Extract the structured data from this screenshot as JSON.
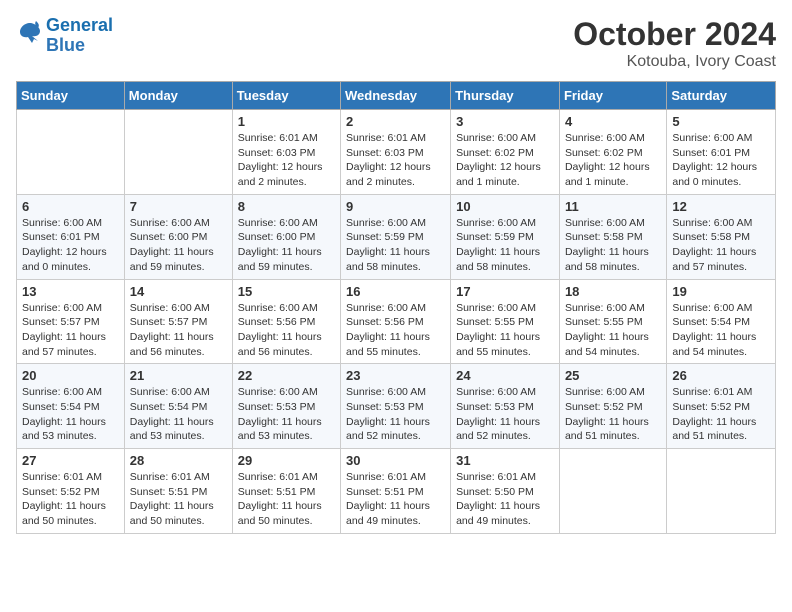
{
  "header": {
    "logo_line1": "General",
    "logo_line2": "Blue",
    "title": "October 2024",
    "subtitle": "Kotouba, Ivory Coast"
  },
  "days_of_week": [
    "Sunday",
    "Monday",
    "Tuesday",
    "Wednesday",
    "Thursday",
    "Friday",
    "Saturday"
  ],
  "weeks": [
    [
      {
        "day": "",
        "info": ""
      },
      {
        "day": "",
        "info": ""
      },
      {
        "day": "1",
        "info": "Sunrise: 6:01 AM\nSunset: 6:03 PM\nDaylight: 12 hours and 2 minutes."
      },
      {
        "day": "2",
        "info": "Sunrise: 6:01 AM\nSunset: 6:03 PM\nDaylight: 12 hours and 2 minutes."
      },
      {
        "day": "3",
        "info": "Sunrise: 6:00 AM\nSunset: 6:02 PM\nDaylight: 12 hours and 1 minute."
      },
      {
        "day": "4",
        "info": "Sunrise: 6:00 AM\nSunset: 6:02 PM\nDaylight: 12 hours and 1 minute."
      },
      {
        "day": "5",
        "info": "Sunrise: 6:00 AM\nSunset: 6:01 PM\nDaylight: 12 hours and 0 minutes."
      }
    ],
    [
      {
        "day": "6",
        "info": "Sunrise: 6:00 AM\nSunset: 6:01 PM\nDaylight: 12 hours and 0 minutes."
      },
      {
        "day": "7",
        "info": "Sunrise: 6:00 AM\nSunset: 6:00 PM\nDaylight: 11 hours and 59 minutes."
      },
      {
        "day": "8",
        "info": "Sunrise: 6:00 AM\nSunset: 6:00 PM\nDaylight: 11 hours and 59 minutes."
      },
      {
        "day": "9",
        "info": "Sunrise: 6:00 AM\nSunset: 5:59 PM\nDaylight: 11 hours and 58 minutes."
      },
      {
        "day": "10",
        "info": "Sunrise: 6:00 AM\nSunset: 5:59 PM\nDaylight: 11 hours and 58 minutes."
      },
      {
        "day": "11",
        "info": "Sunrise: 6:00 AM\nSunset: 5:58 PM\nDaylight: 11 hours and 58 minutes."
      },
      {
        "day": "12",
        "info": "Sunrise: 6:00 AM\nSunset: 5:58 PM\nDaylight: 11 hours and 57 minutes."
      }
    ],
    [
      {
        "day": "13",
        "info": "Sunrise: 6:00 AM\nSunset: 5:57 PM\nDaylight: 11 hours and 57 minutes."
      },
      {
        "day": "14",
        "info": "Sunrise: 6:00 AM\nSunset: 5:57 PM\nDaylight: 11 hours and 56 minutes."
      },
      {
        "day": "15",
        "info": "Sunrise: 6:00 AM\nSunset: 5:56 PM\nDaylight: 11 hours and 56 minutes."
      },
      {
        "day": "16",
        "info": "Sunrise: 6:00 AM\nSunset: 5:56 PM\nDaylight: 11 hours and 55 minutes."
      },
      {
        "day": "17",
        "info": "Sunrise: 6:00 AM\nSunset: 5:55 PM\nDaylight: 11 hours and 55 minutes."
      },
      {
        "day": "18",
        "info": "Sunrise: 6:00 AM\nSunset: 5:55 PM\nDaylight: 11 hours and 54 minutes."
      },
      {
        "day": "19",
        "info": "Sunrise: 6:00 AM\nSunset: 5:54 PM\nDaylight: 11 hours and 54 minutes."
      }
    ],
    [
      {
        "day": "20",
        "info": "Sunrise: 6:00 AM\nSunset: 5:54 PM\nDaylight: 11 hours and 53 minutes."
      },
      {
        "day": "21",
        "info": "Sunrise: 6:00 AM\nSunset: 5:54 PM\nDaylight: 11 hours and 53 minutes."
      },
      {
        "day": "22",
        "info": "Sunrise: 6:00 AM\nSunset: 5:53 PM\nDaylight: 11 hours and 53 minutes."
      },
      {
        "day": "23",
        "info": "Sunrise: 6:00 AM\nSunset: 5:53 PM\nDaylight: 11 hours and 52 minutes."
      },
      {
        "day": "24",
        "info": "Sunrise: 6:00 AM\nSunset: 5:53 PM\nDaylight: 11 hours and 52 minutes."
      },
      {
        "day": "25",
        "info": "Sunrise: 6:00 AM\nSunset: 5:52 PM\nDaylight: 11 hours and 51 minutes."
      },
      {
        "day": "26",
        "info": "Sunrise: 6:01 AM\nSunset: 5:52 PM\nDaylight: 11 hours and 51 minutes."
      }
    ],
    [
      {
        "day": "27",
        "info": "Sunrise: 6:01 AM\nSunset: 5:52 PM\nDaylight: 11 hours and 50 minutes."
      },
      {
        "day": "28",
        "info": "Sunrise: 6:01 AM\nSunset: 5:51 PM\nDaylight: 11 hours and 50 minutes."
      },
      {
        "day": "29",
        "info": "Sunrise: 6:01 AM\nSunset: 5:51 PM\nDaylight: 11 hours and 50 minutes."
      },
      {
        "day": "30",
        "info": "Sunrise: 6:01 AM\nSunset: 5:51 PM\nDaylight: 11 hours and 49 minutes."
      },
      {
        "day": "31",
        "info": "Sunrise: 6:01 AM\nSunset: 5:50 PM\nDaylight: 11 hours and 49 minutes."
      },
      {
        "day": "",
        "info": ""
      },
      {
        "day": "",
        "info": ""
      }
    ]
  ]
}
